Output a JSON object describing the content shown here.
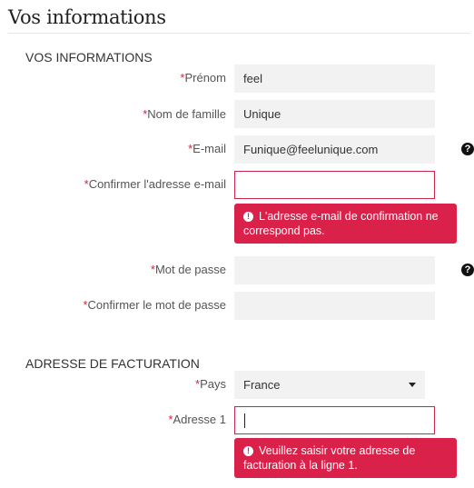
{
  "page_title": "Vos informations",
  "sections": {
    "personal": "VOS INFORMATIONS",
    "billing": "ADRESSE DE FACTURATION"
  },
  "required_marker": "*",
  "fields": {
    "first_name": {
      "label": "Prénom",
      "value": "feel"
    },
    "last_name": {
      "label": "Nom de famille",
      "value": "Unique"
    },
    "email": {
      "label": "E-mail",
      "value": "Funique@feelunique.com"
    },
    "confirm_email": {
      "label": "Confirmer l'adresse e-mail",
      "value": ""
    },
    "password": {
      "label": "Mot de passe",
      "value": ""
    },
    "confirm_password": {
      "label": "Confirmer le mot de passe",
      "value": ""
    },
    "country": {
      "label": "Pays",
      "value": "France"
    },
    "address1": {
      "label": "Adresse 1",
      "value": ""
    }
  },
  "errors": {
    "confirm_email": "L'adresse e-mail de confirmation ne correspond pas.",
    "address1": "Veuillez saisir votre adresse de facturation à la ligne 1."
  },
  "icons": {
    "help": "?",
    "error": "!"
  },
  "colors": {
    "required": "#d0213f",
    "error_background": "#d9214a",
    "error_border": "#c9244a",
    "input_background": "#f2f2f2"
  }
}
